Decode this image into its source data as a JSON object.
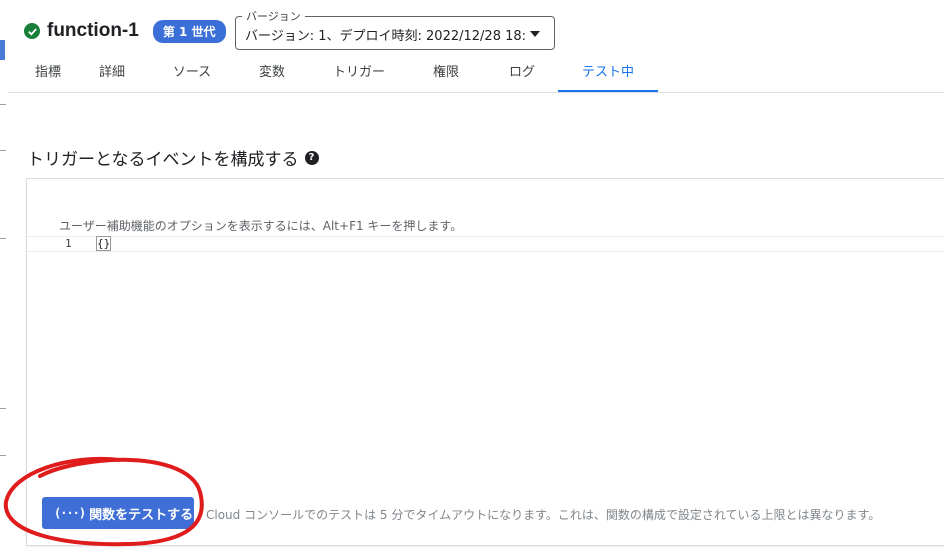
{
  "header": {
    "function_name": "function-1",
    "status_icon": "check-circle-icon",
    "status_color": "#188038",
    "generation_badge": "第 1 世代"
  },
  "version": {
    "legend": "バージョン",
    "value": "バージョン: 1、デプロイ時刻: 2022/12/28 18:..."
  },
  "tabs": [
    {
      "label": "指標"
    },
    {
      "label": "詳細"
    },
    {
      "label": "ソース"
    },
    {
      "label": "変数"
    },
    {
      "label": "トリガー"
    },
    {
      "label": "権限"
    },
    {
      "label": "ログ"
    },
    {
      "label": "テスト中",
      "active": true
    }
  ],
  "section": {
    "title": "トリガーとなるイベントを構成する",
    "help_icon": "help-icon"
  },
  "editor": {
    "a11y_hint": "ユーザー補助機能のオプションを表示するには、Alt+F1 キーを押します。",
    "line_number": "1",
    "code": "{}"
  },
  "actions": {
    "test_button_label": "関数をテストする",
    "test_button_icon": "function-icon",
    "timeout_note": "Cloud コンソールでのテストは 5 分でタイムアウトになります。これは、関数の構成で設定されている上限とは異なります。"
  },
  "colors": {
    "accent": "#1a73e8",
    "badge": "#3a6fd8",
    "button": "#3f6ed6",
    "annotation": "#e01b1b"
  }
}
